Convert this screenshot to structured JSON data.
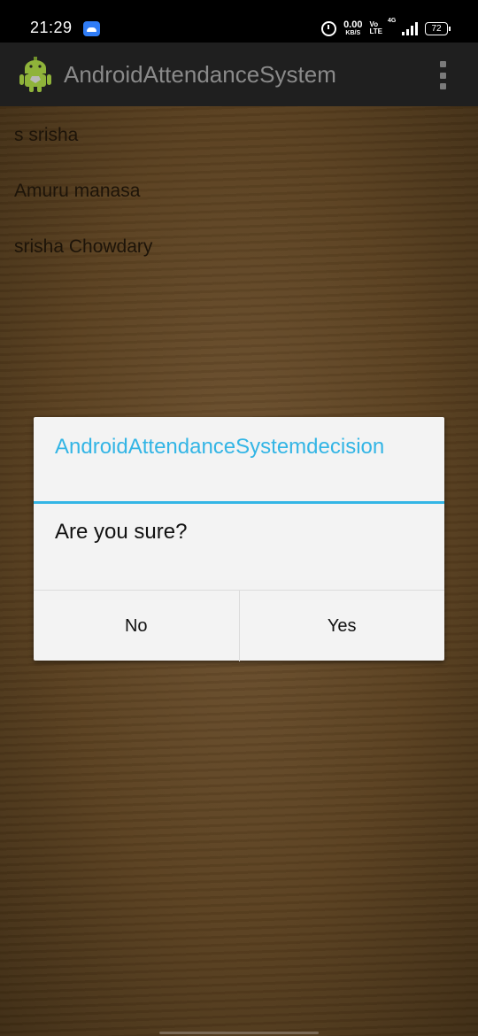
{
  "status_bar": {
    "time": "21:29",
    "net_speed_value": "0.00",
    "net_speed_unit": "KB/S",
    "volte_top": "Vo",
    "volte_bottom": "LTE",
    "network_type": "4G",
    "battery": "72",
    "icons": [
      "app-notification-icon",
      "alarm-icon",
      "signal-icon",
      "battery-icon"
    ]
  },
  "app_bar": {
    "title": "AndroidAttendanceSystem",
    "logo_icon": "android-robot-icon",
    "menu_icon": "overflow-menu-icon"
  },
  "list": {
    "items": [
      {
        "label": "s srisha"
      },
      {
        "label": "Amuru manasa"
      },
      {
        "label": "srisha Chowdary"
      }
    ]
  },
  "dialog": {
    "title": "AndroidAttendanceSystemdecision",
    "message": "Are you sure?",
    "negative_label": "No",
    "positive_label": "Yes",
    "accent_color": "#33b5e5"
  }
}
